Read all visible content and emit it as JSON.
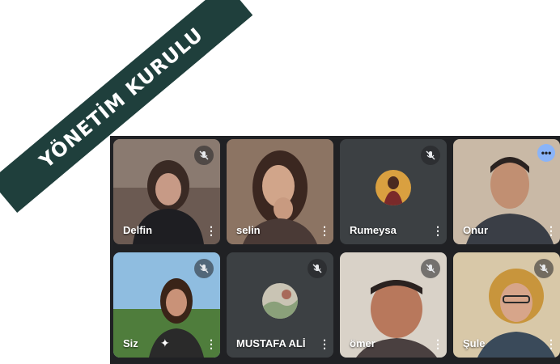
{
  "banner": {
    "text": "YÖNETİM KURULU",
    "color": "#1f3f3c"
  },
  "participants": [
    {
      "name": "Delfin",
      "muted": true,
      "video": "camera"
    },
    {
      "name": "selin",
      "muted": false,
      "video": "camera"
    },
    {
      "name": "Rumeysa",
      "muted": true,
      "video": "avatar"
    },
    {
      "name": "Onur",
      "muted": false,
      "video": "camera",
      "speaking": true
    },
    {
      "name": "Siz",
      "muted": true,
      "video": "camera",
      "effects": true
    },
    {
      "name": "MUSTAFA ALİ",
      "muted": true,
      "video": "avatar"
    },
    {
      "name": "ömer",
      "muted": true,
      "video": "camera"
    },
    {
      "name": "Şule",
      "muted": true,
      "video": "camera"
    }
  ],
  "icons": {
    "mute": "mic-off-icon",
    "more": "more-vert-icon",
    "effects": "sparkle-icon",
    "speaking": "speaking-dots-icon"
  },
  "more_glyph": "⋮",
  "sparkle_glyph": "✦",
  "speaking_glyph": "•••"
}
